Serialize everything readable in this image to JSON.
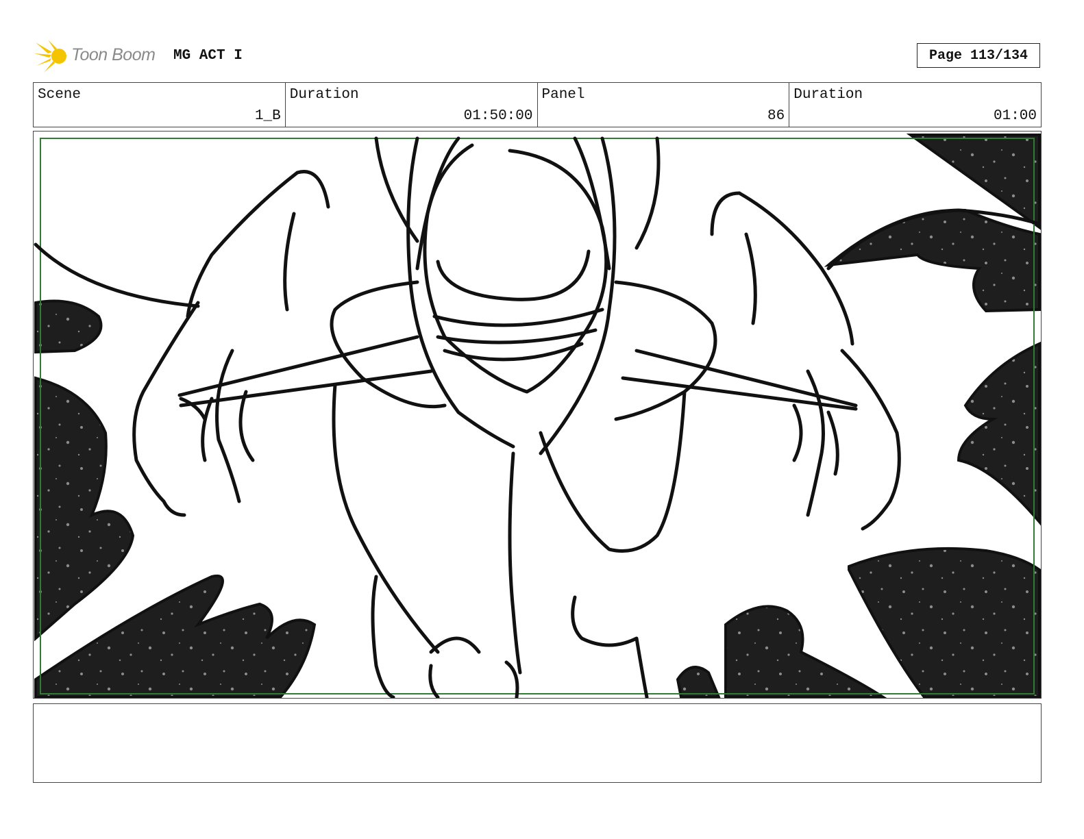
{
  "header": {
    "logo_text": "Toon Boom",
    "project_title": "MG ACT I",
    "page_label": "Page 113/134"
  },
  "info": [
    {
      "label": "Scene",
      "value": "1_B"
    },
    {
      "label": "Duration",
      "value": "01:50:00"
    },
    {
      "label": "Panel",
      "value": "86"
    },
    {
      "label": "Duration",
      "value": "01:00"
    }
  ],
  "panel": {
    "safe_frame_color": "#2e7d32",
    "ink_color": "#111111",
    "fill_dark": "#1e1e1e",
    "speckle_color": "#8c8c8c"
  },
  "notes": {
    "text": ""
  }
}
